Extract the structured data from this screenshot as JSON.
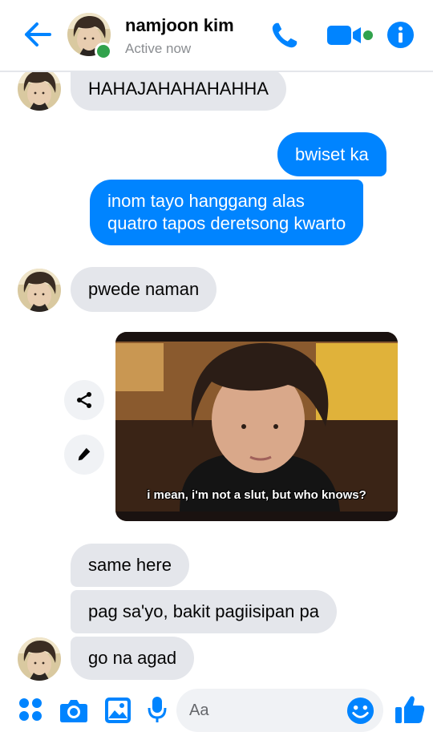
{
  "header": {
    "name": "namjoon kim",
    "status": "Active now"
  },
  "messages": [
    {
      "text": "HAHAJAHAHAHAHHA",
      "from": "them"
    },
    {
      "text": "bwiset ka",
      "from": "me"
    },
    {
      "line1": "inom tayo hanggang alas",
      "line2": "quatro tapos deretsong kwarto",
      "from": "me"
    },
    {
      "text": "pwede naman",
      "from": "them"
    },
    {
      "caption": "i mean, i'm not a slut, but who knows?",
      "from": "them",
      "type": "image"
    },
    {
      "text": "same here",
      "from": "them"
    },
    {
      "text": "pag sa'yo, bakit pagiisipan pa",
      "from": "them"
    },
    {
      "text": "go na agad",
      "from": "them"
    }
  ],
  "composer": {
    "placeholder": "Aa"
  },
  "icons": {
    "back": "back-arrow-icon",
    "call": "phone-icon",
    "video": "video-camera-icon",
    "info": "info-icon",
    "share": "share-icon",
    "edit": "pencil-icon",
    "more": "grid-dots-icon",
    "camera": "camera-icon",
    "gallery": "image-icon",
    "mic": "microphone-icon",
    "emoji": "emoji-icon",
    "like": "thumbs-up-icon"
  },
  "colors": {
    "accent": "#0084ff",
    "incoming_bubble": "#e4e6eb",
    "online": "#31a24c"
  }
}
